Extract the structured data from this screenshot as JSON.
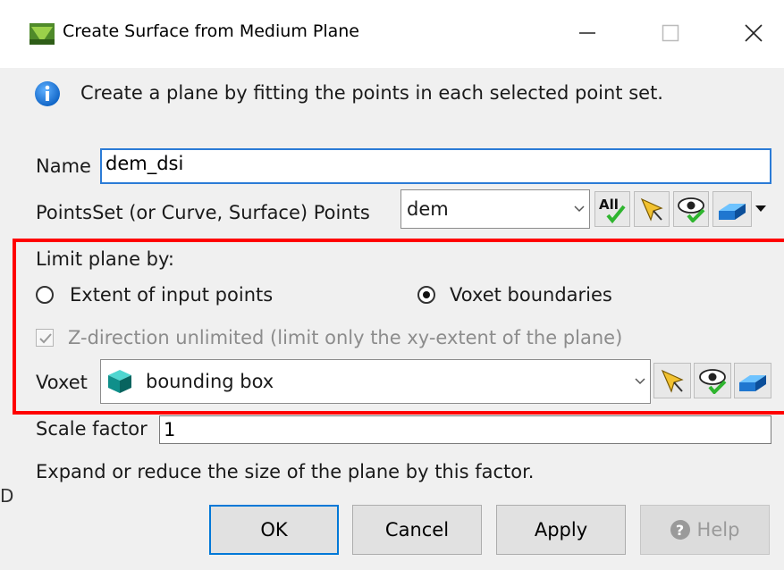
{
  "window": {
    "title": "Create Surface from Medium Plane",
    "app_icon": "gocad-app-icon",
    "controls": [
      "minimize-icon",
      "maximize-icon",
      "close-icon"
    ]
  },
  "info": {
    "icon": "info-icon",
    "text": "Create a plane by fitting the points in each selected point set."
  },
  "name": {
    "label": "Name",
    "value": "dem_dsi"
  },
  "points": {
    "label": "PointsSet (or Curve, Surface) Points",
    "selected": "dem",
    "tools": [
      "select-all-icon",
      "pick-arrow-icon",
      "eye-icon",
      "object-3d-icon"
    ],
    "all_label": "All"
  },
  "limit": {
    "label": "Limit plane by:",
    "options": [
      {
        "label": "Extent of input points",
        "checked": false
      },
      {
        "label": "Voxet boundaries",
        "checked": true
      }
    ],
    "z_direction": {
      "label": "Z-direction unlimited (limit only the xy-extent of the plane)",
      "checked": true,
      "enabled": false
    },
    "voxet": {
      "label": "Voxet",
      "selected": "bounding box",
      "icon": "voxet-cube-icon"
    }
  },
  "scale": {
    "label": "Scale factor",
    "value": "1",
    "hint": "Expand or reduce the size of the plane by this factor."
  },
  "buttons": {
    "ok": "OK",
    "cancel": "Cancel",
    "apply": "Apply",
    "help": "Help"
  },
  "edge_letter": "D",
  "colors": {
    "highlight_border": "#ff0000",
    "focus_border": "#2b7bd6",
    "accent_blue": "#0078d7"
  }
}
